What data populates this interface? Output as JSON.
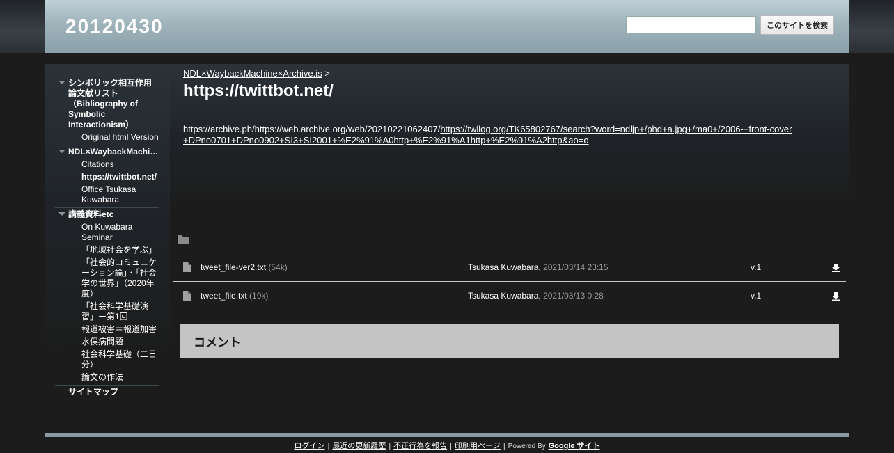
{
  "header": {
    "site_title": "20120430",
    "search_placeholder": "",
    "search_button": "このサイトを検索"
  },
  "sidebar": {
    "groups": [
      {
        "label": "シンボリック相互作用論文献リスト（Bibliography of Symbolic Interactionism）",
        "items": [
          "Original html Version"
        ]
      },
      {
        "label": "NDL×WaybackMachine×Archive.is",
        "items": [
          "Citations",
          "https://twittbot.net/",
          "Office Tsukasa Kuwabara"
        ]
      },
      {
        "label": "講義資料etc",
        "items": [
          "On Kuwabara Seminar",
          "「地域社会を学ぶ」",
          "「社会的コミュニケーション論」・「社会学の世界」（2020年度）",
          "「社会科学基礎演習」ー第1回",
          "報道被害＝報道加害",
          "水俣病問題",
          "社会科学基礎（二日分）",
          "論文の作法"
        ]
      }
    ],
    "sitemap": "サイトマップ"
  },
  "main": {
    "breadcrumb_link": "NDL×WaybackMachine×Archive.is",
    "breadcrumb_sep": ">",
    "title": "https://twittbot.net/",
    "body_prefix": "https://archive.ph/https://web.archive.org/web/20210221062407/",
    "body_link": "https://twilog.org/TK65802767/search?word=ndljp+/phd+a.jpg+/ma0+/2006-+front-cover+DPno0701+DPno0902+SI3+SI2001+%E2%91%A0http+%E2%91%A1http+%E2%91%A2http&ao=o",
    "files": [
      {
        "name": "tweet_file-ver2.txt",
        "size": "(54k)",
        "author": "Tsukasa Kuwabara,",
        "date": "2021/03/14 23:15",
        "version": "v.1"
      },
      {
        "name": "tweet_file.txt",
        "size": "(19k)",
        "author": "Tsukasa Kuwabara,",
        "date": "2021/03/13 0:28",
        "version": "v.1"
      }
    ],
    "comment_title": "コメント"
  },
  "footer": {
    "links": [
      "ログイン",
      "最近の更新履歴",
      "不正行為を報告",
      "印刷用ページ"
    ],
    "sep": "|",
    "powered_by": "Powered By",
    "google_sites": "Google サイト"
  },
  "colors": {
    "background": "#1c1c1c",
    "header": "#9fb3bb",
    "comment_box": "#c4c4c4",
    "footer_bar": "#8a9ba3"
  }
}
